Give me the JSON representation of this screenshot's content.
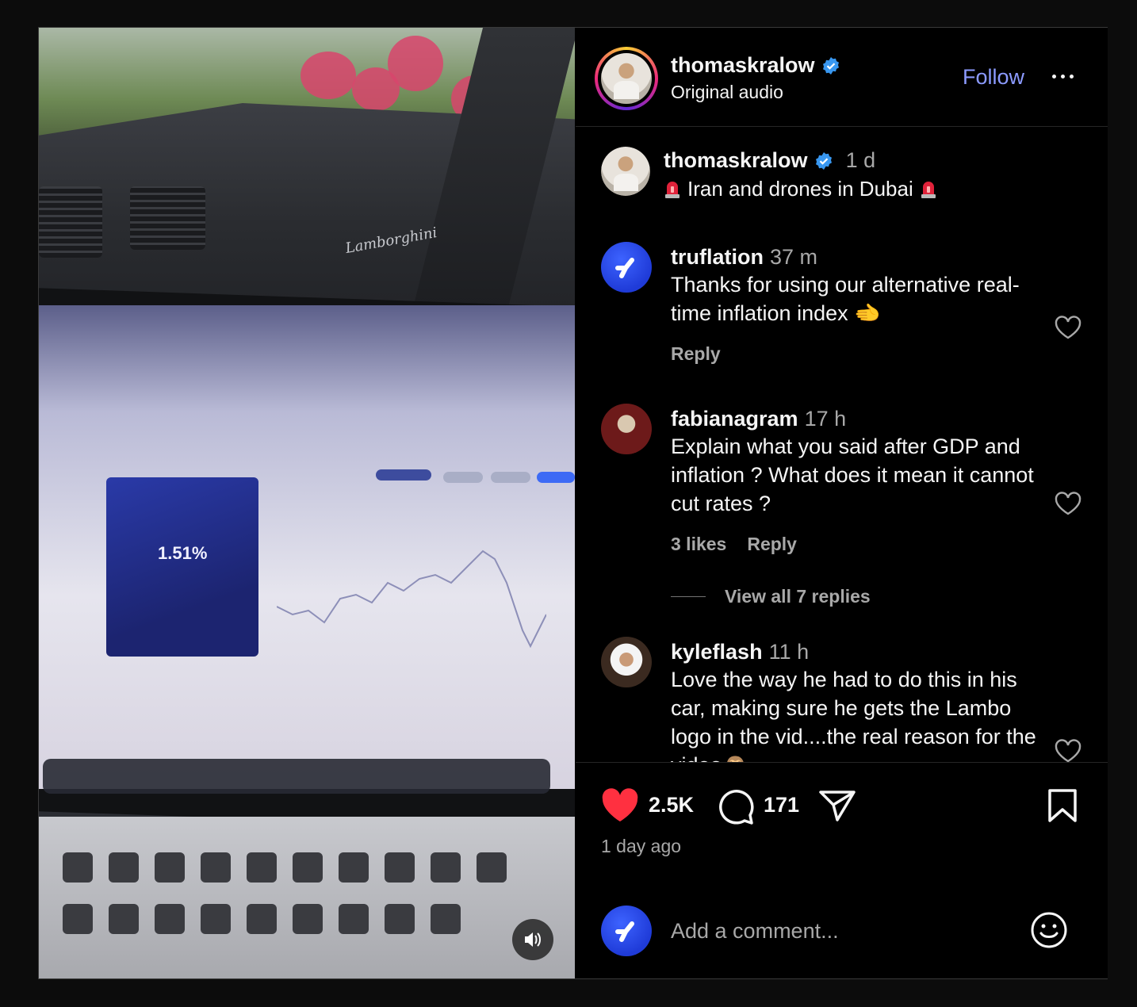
{
  "header": {
    "username": "thomaskralow",
    "subtitle": "Original audio",
    "follow_label": "Follow",
    "more_icon": "more-horizontal-icon"
  },
  "caption": {
    "username": "thomaskralow",
    "time": "1 d",
    "text": "Iran and drones in Dubai",
    "emoji": "police-siren-emoji"
  },
  "comments": [
    {
      "username": "truflation",
      "time": "37 m",
      "text": "Thanks for using our alternative real-time inflation index 🫲",
      "likes": "",
      "reply_label": "Reply"
    },
    {
      "username": "fabianagram",
      "time": "17 h",
      "text": "Explain what you said after GDP and inflation ? What does it mean it cannot cut rates ?",
      "likes": "3 likes",
      "reply_label": "Reply",
      "view_replies": "View all 7 replies"
    },
    {
      "username": "kyleflash",
      "time": "11 h",
      "text": "Love the way he had to do this in his car, making sure he gets the Lambo logo in the vid....the real reason for the video🙈"
    }
  ],
  "actions": {
    "like_count": "2.5K",
    "comment_count": "171",
    "time_ago": "1 day ago"
  },
  "add_comment": {
    "placeholder": "Add a comment..."
  },
  "media": {
    "brand_text": "Lamborghini",
    "screen_value": "1.51%",
    "sound_icon": "speaker-on-icon"
  },
  "colors": {
    "accent": "#8c9bff",
    "verified": "#3897f0",
    "like": "#ff3040",
    "muted": "#a8a8a8"
  }
}
